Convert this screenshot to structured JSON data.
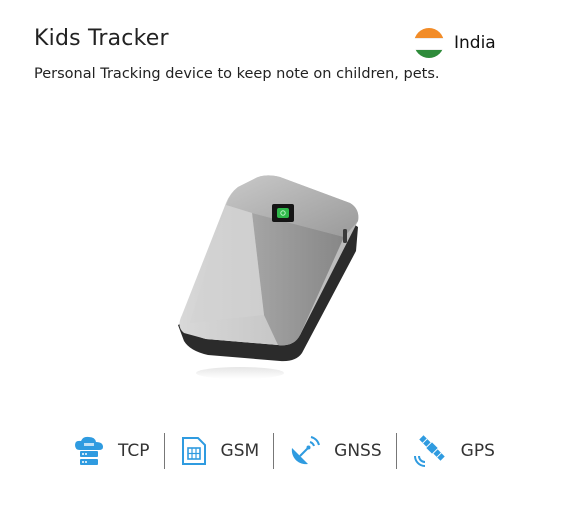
{
  "product": {
    "title": "Kids Tracker",
    "description": "Personal Tracking device to keep note on children, pets."
  },
  "country": {
    "name": "India",
    "flag_icon": "india-flag-icon",
    "flag_colors": [
      "#f28c28",
      "#ffffff",
      "#2e8b3a"
    ]
  },
  "features": [
    {
      "label": "TCP",
      "icon": "cloud-server-icon"
    },
    {
      "label": "GSM",
      "icon": "sim-card-icon"
    },
    {
      "label": "GNSS",
      "icon": "satellite-dish-icon"
    },
    {
      "label": "GPS",
      "icon": "satellite-icon"
    }
  ],
  "colors": {
    "icon_accent": "#2f9be0",
    "device_led": "#2fb84a"
  }
}
